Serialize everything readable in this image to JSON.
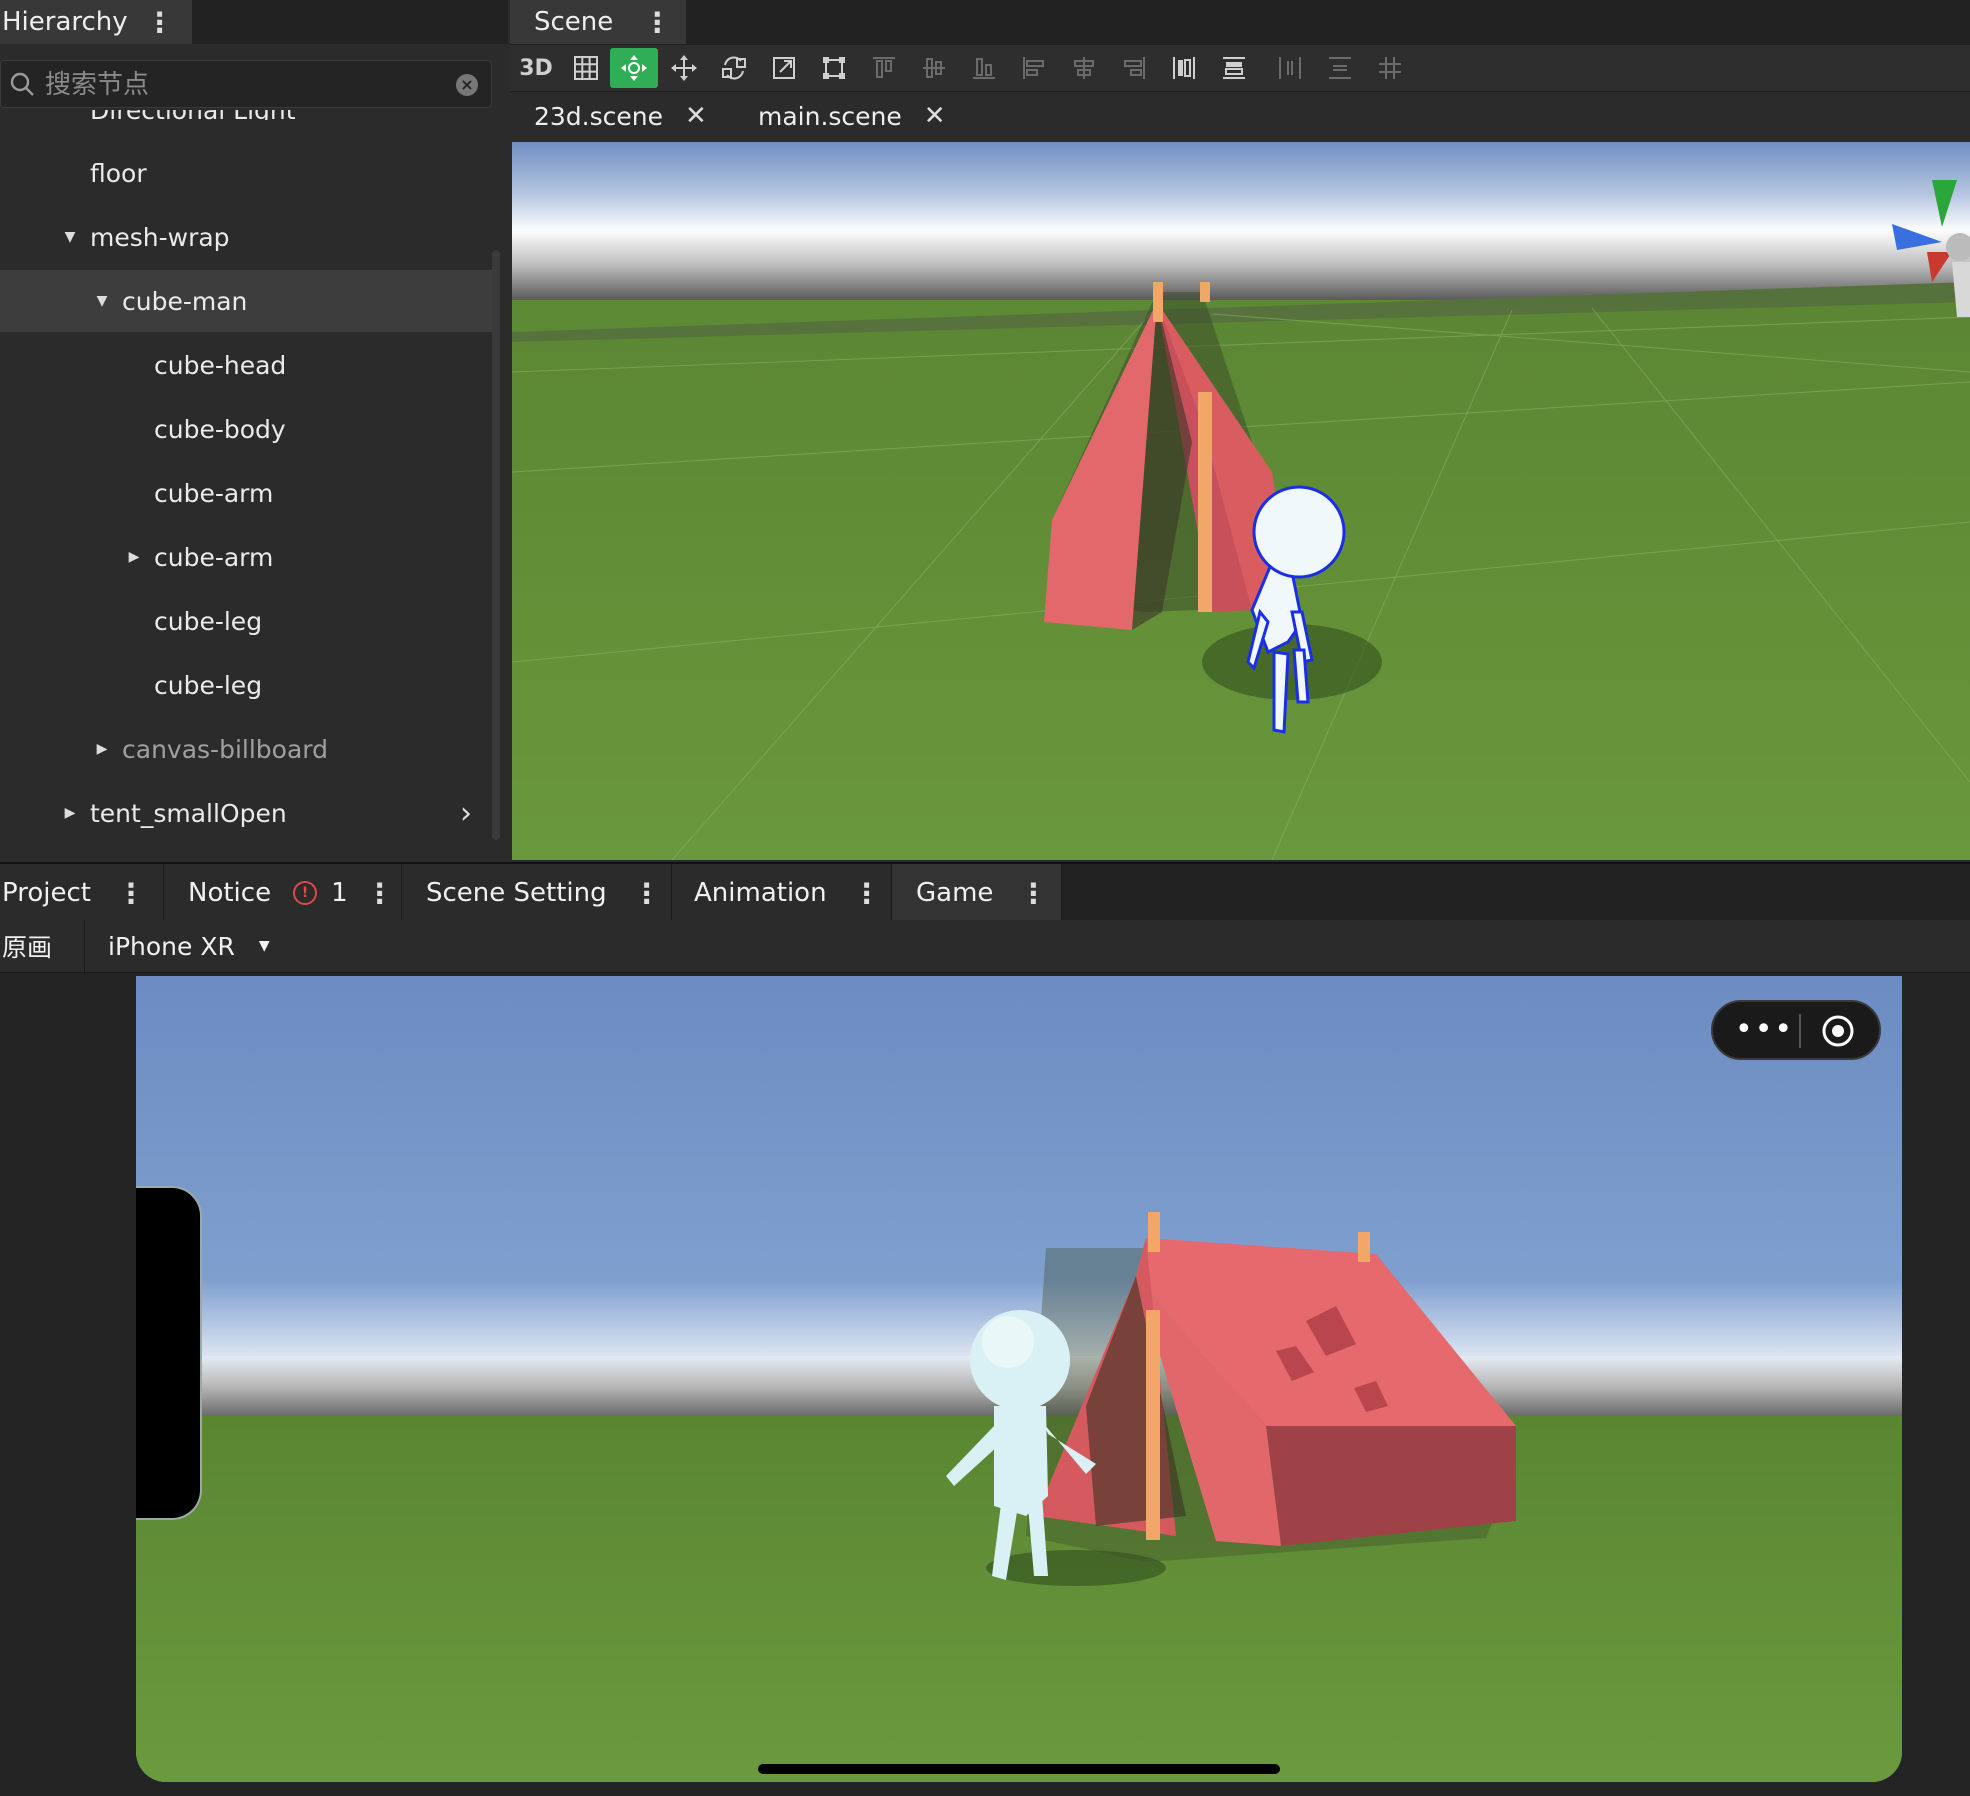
{
  "hierarchy": {
    "title": "Hierarchy",
    "search_placeholder": "搜索节点",
    "partial_item": "Directional Light",
    "items": [
      {
        "label": "floor"
      },
      {
        "label": "mesh-wrap"
      },
      {
        "label": "cube-man"
      },
      {
        "label": "cube-head"
      },
      {
        "label": "cube-body"
      },
      {
        "label": "cube-arm"
      },
      {
        "label": "cube-arm"
      },
      {
        "label": "cube-leg"
      },
      {
        "label": "cube-leg"
      },
      {
        "label": "canvas-billboard"
      },
      {
        "label": "tent_smallOpen"
      }
    ]
  },
  "scene": {
    "title": "Scene",
    "mode_label": "3D",
    "files": [
      {
        "label": "23d.scene"
      },
      {
        "label": "main.scene"
      }
    ]
  },
  "bottom": {
    "tabs": [
      {
        "label": "Project"
      },
      {
        "label": "Notice",
        "count": "1"
      },
      {
        "label": "Scene Setting"
      },
      {
        "label": "Animation"
      },
      {
        "label": "Game"
      }
    ],
    "scale_label": "原画",
    "device": "iPhone XR"
  },
  "colors": {
    "accent": "#2fae55",
    "selection": "#3d3d3d",
    "notice": "#e04848",
    "tent": "#e2686c",
    "grass": "#5e8a36",
    "sky": "#6f8fc2"
  }
}
